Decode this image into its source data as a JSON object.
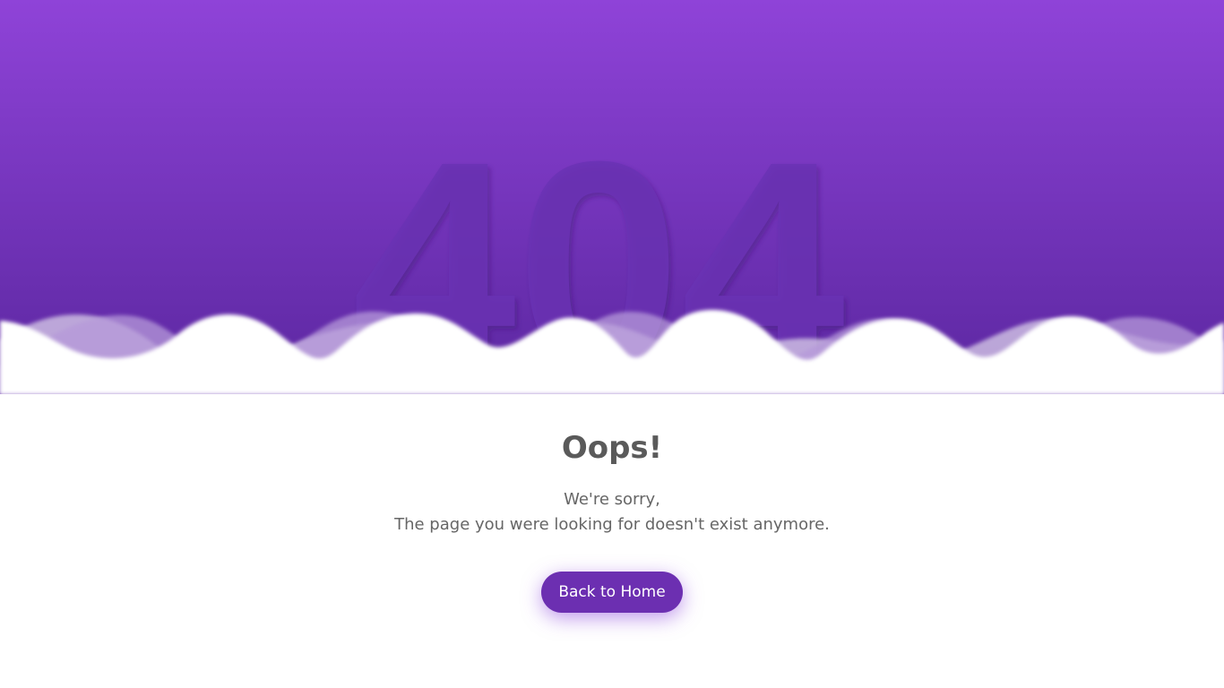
{
  "hero": {
    "error_code": "404",
    "colors": {
      "gradient_top": "#8f43d8",
      "gradient_bottom": "#5b27a0",
      "wave_back": "#d9cfe8",
      "wave_mid": "#b59ad9"
    }
  },
  "content": {
    "title": "Oops!",
    "message_line1": "We're sorry,",
    "message_line2": "The page you were looking for doesn't exist anymore.",
    "button_label": "Back to Home",
    "colors": {
      "title": "#5a5a5a",
      "text": "#666666",
      "button_bg": "#6c2fb1",
      "button_text": "#ffffff"
    }
  }
}
